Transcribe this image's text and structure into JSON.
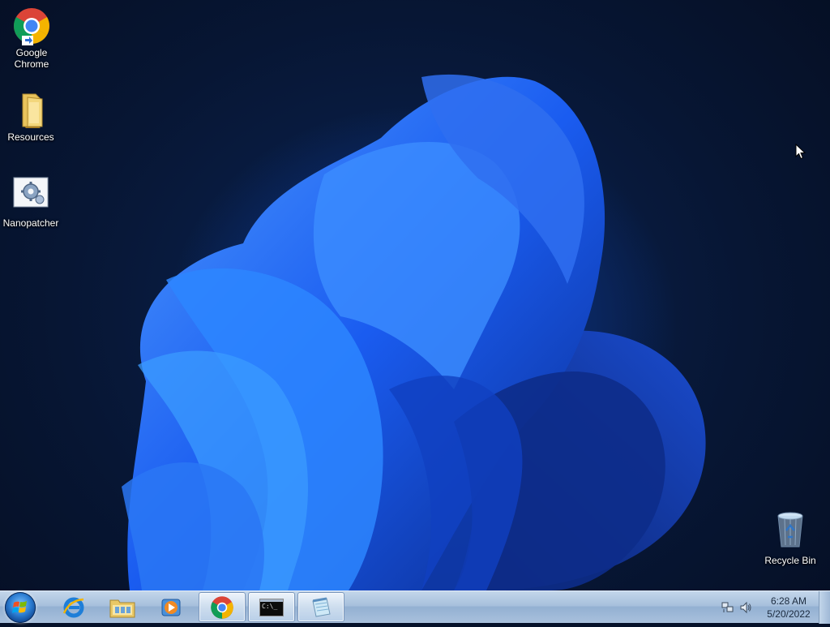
{
  "desktop": {
    "icons": [
      {
        "label_line1": "Google",
        "label_line2": "Chrome",
        "icon": "chrome-icon"
      },
      {
        "label": "Resources",
        "icon": "folder-icon"
      },
      {
        "label": "Nanopatcher",
        "icon": "nanopatcher-icon"
      },
      {
        "label": "Recycle Bin",
        "icon": "recycle-bin-icon"
      }
    ]
  },
  "taskbar": {
    "start": {
      "icon": "windows-start-icon"
    },
    "items": [
      {
        "icon": "internet-explorer-icon",
        "active": false
      },
      {
        "icon": "file-explorer-icon",
        "active": false
      },
      {
        "icon": "media-player-icon",
        "active": false
      },
      {
        "icon": "chrome-icon",
        "active": true
      },
      {
        "icon": "command-prompt-icon",
        "active": true,
        "text": "C:\\_"
      },
      {
        "icon": "notepad-icon",
        "active": true
      }
    ],
    "tray": {
      "icons": [
        "network-icon",
        "volume-icon"
      ],
      "time": "6:28 AM",
      "date": "5/20/2022"
    }
  },
  "colors": {
    "wallpaper_dark": "#06122a",
    "wallpaper_blue": "#1f5cf2",
    "taskbar": "#a7c0dc"
  }
}
